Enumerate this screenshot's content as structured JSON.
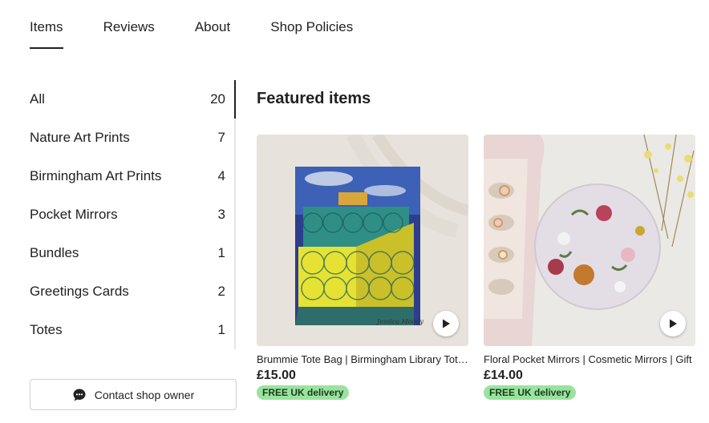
{
  "tabs": [
    {
      "label": "Items"
    },
    {
      "label": "Reviews"
    },
    {
      "label": "About"
    },
    {
      "label": "Shop Policies"
    }
  ],
  "sidebar": {
    "items": [
      {
        "label": "All",
        "count": "20"
      },
      {
        "label": "Nature Art Prints",
        "count": "7"
      },
      {
        "label": "Birmingham Art Prints",
        "count": "4"
      },
      {
        "label": "Pocket Mirrors",
        "count": "3"
      },
      {
        "label": "Bundles",
        "count": "1"
      },
      {
        "label": "Greetings Cards",
        "count": "2"
      },
      {
        "label": "Totes",
        "count": "1"
      }
    ],
    "contact_label": "Contact shop owner"
  },
  "main": {
    "featured_title": "Featured items",
    "cards": [
      {
        "title": "Brummie Tote Bag | Birmingham Library Tote Bag",
        "price": "£15.00",
        "badge": "FREE UK delivery",
        "image_icon": "tote-bag-image"
      },
      {
        "title": "Floral Pocket Mirrors | Cosmetic Mirrors | Gift",
        "price": "£14.00",
        "badge": "FREE UK delivery",
        "image_icon": "pocket-mirror-image"
      }
    ]
  },
  "colors": {
    "badge_bg": "#9ae39e",
    "text": "#222222",
    "rail": "#e6e6e6"
  }
}
